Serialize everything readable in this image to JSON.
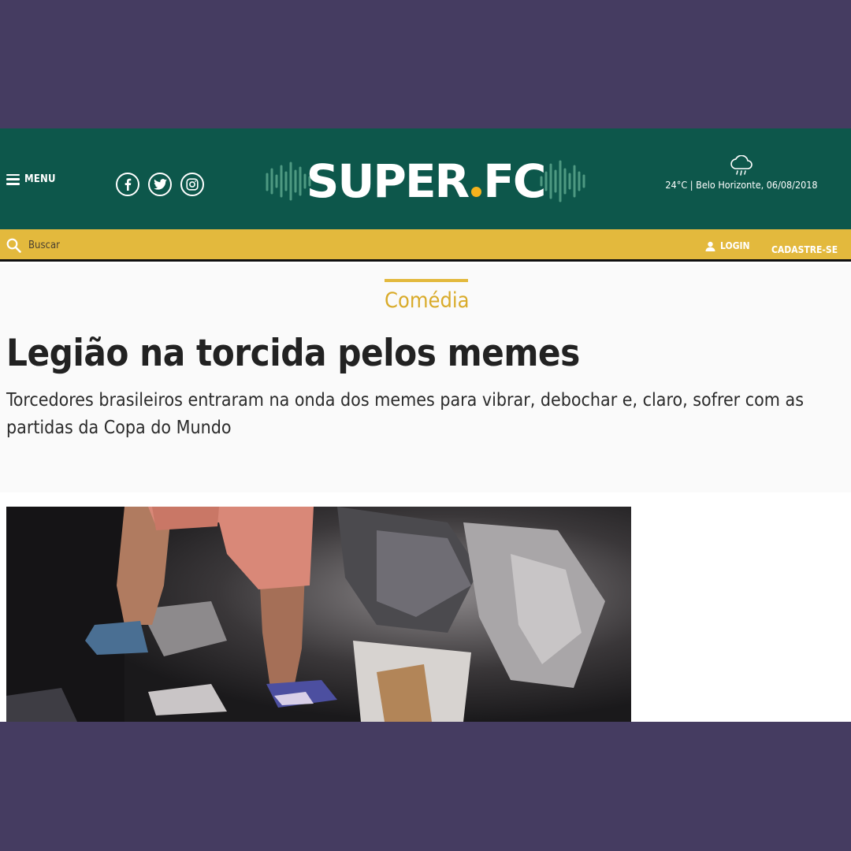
{
  "header": {
    "menu_label": "MENU",
    "social_icons": [
      "facebook-icon",
      "twitter-icon",
      "instagram-icon"
    ],
    "logo": {
      "text_left": "SUPER",
      "text_right": "FC",
      "dot_color": "#f5b21d"
    },
    "weather": {
      "icon": "rain-cloud-icon",
      "text": "24°C | Belo Horizonte, 06/08/2018"
    },
    "background_color": "#0d574b"
  },
  "subbar": {
    "search_placeholder": "Buscar",
    "login_label": "LOGIN",
    "signup_label": "CADASTRE-SE",
    "background_color": "#e3b93d"
  },
  "article": {
    "category": "Comédia",
    "headline": "Legião na torcida pelos memes",
    "subheadline": "Torcedores brasileiros entraram na onda dos memes para vibrar, debochar e, claro, sofrer com as partidas da Copa do Mundo"
  },
  "colors": {
    "page_background": "#453c61",
    "accent": "#e3b93d"
  }
}
